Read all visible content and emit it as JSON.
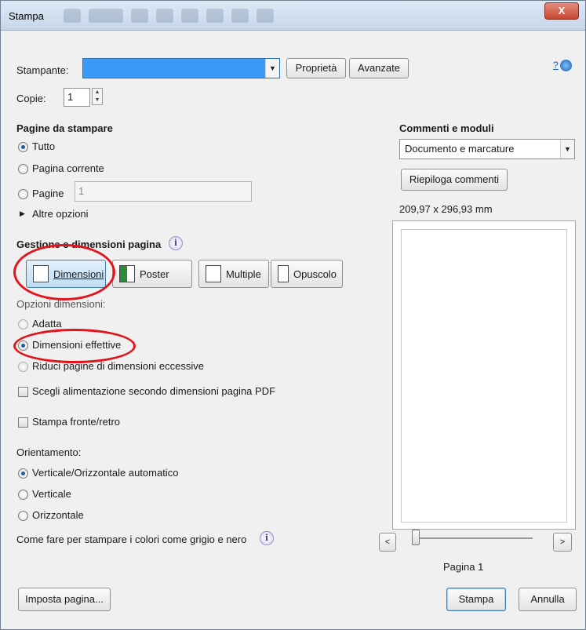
{
  "window": {
    "title": "Stampa",
    "close_label": "X"
  },
  "printer": {
    "label": "Stampante:",
    "value": "",
    "properties_label": "Proprietà",
    "advanced_label": "Avanzate",
    "help_label": "?"
  },
  "copies": {
    "label": "Copie:",
    "value": "1"
  },
  "pages": {
    "heading": "Pagine da stampare",
    "all_label": "Tutto",
    "current_label": "Pagina corrente",
    "range_label": "Pagine",
    "range_value": "1",
    "more_label": "Altre opzioni"
  },
  "sizing": {
    "heading": "Gestione e dimensioni pagina",
    "tabs": [
      {
        "label": "Dimensioni",
        "selected": true,
        "icon": "size-icon"
      },
      {
        "label": "Poster",
        "selected": false,
        "icon": "poster-icon"
      },
      {
        "label": "Multiple",
        "selected": false,
        "icon": "multiple-icon"
      },
      {
        "label": "Opuscolo",
        "selected": false,
        "icon": "booklet-icon"
      }
    ],
    "options_heading": "Opzioni dimensioni:",
    "fit_label": "Adatta",
    "actual_label": "Dimensioni effettive",
    "shrink_label": "Riduci pagine di dimensioni eccessive",
    "paper_source_label": "Scegli alimentazione secondo dimensioni pagina PDF",
    "duplex_label": "Stampa fronte/retro"
  },
  "orientation": {
    "heading": "Orientamento:",
    "auto_label": "Verticale/Orizzontale automatico",
    "portrait_label": "Verticale",
    "landscape_label": "Orizzontale"
  },
  "grayscale_help": "Come fare per stampare i colori come grigio e nero",
  "comments": {
    "heading": "Commenti e moduli",
    "value": "Documento e marcature",
    "summarize_label": "Riepiloga commenti",
    "page_size": "209,97 x 296,93 mm"
  },
  "preview": {
    "prev_label": "<",
    "next_label": ">",
    "page_label": "Pagina 1"
  },
  "footer": {
    "page_setup_label": "Imposta pagina...",
    "print_label": "Stampa",
    "cancel_label": "Annulla"
  },
  "colors": {
    "printer_selected": "#3b9af5",
    "annotation": "#e2141c",
    "accent": "#1d5aa8"
  }
}
